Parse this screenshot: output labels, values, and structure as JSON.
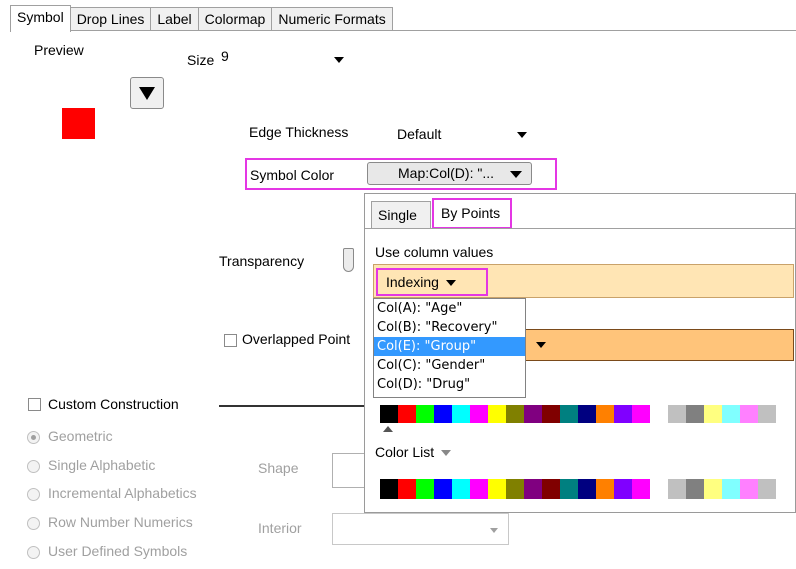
{
  "tabs": [
    "Symbol",
    "Drop Lines",
    "Label",
    "Colormap",
    "Numeric Formats"
  ],
  "preview_label": "Preview",
  "size": {
    "label": "Size",
    "value": "9"
  },
  "edge": {
    "label": "Edge Thickness",
    "value": "Default"
  },
  "symbol_color": {
    "label": "Symbol Color",
    "value": "Map:Col(D): \"..."
  },
  "transparency": {
    "label": "Transparency"
  },
  "overlapped": {
    "label": "Overlapped Point"
  },
  "custom": {
    "label": "Custom Construction"
  },
  "radios": [
    "Geometric",
    "Single Alphabetic",
    "Incremental Alphabetics",
    "Row Number Numerics",
    "User Defined Symbols"
  ],
  "shape_label": "Shape",
  "interior_label": "Interior",
  "popup": {
    "tabs": [
      "Single",
      "By Points"
    ],
    "use_column_label": "Use column values",
    "indexing_label": "Indexing",
    "columns": [
      "Col(A): \"Age\"",
      "Col(B): \"Recovery\"",
      "Col(E): \"Group\"",
      "Col(C): \"Gender\"",
      "Col(D): \"Drug\""
    ],
    "selected_column": "Col(E): \"Group\"",
    "color_list_label": "Color List"
  },
  "colors": {
    "accent_highlight": "#e436e4",
    "symbol_preview": "#ff0000",
    "selection": "#3399ff",
    "combo_bg": "#ffe5b4",
    "orange_bar": "#ffc47a",
    "palette": [
      "#000000",
      "#ff0000",
      "#00ff00",
      "#0000ff",
      "#00ffff",
      "#ff00ff",
      "#ffff00",
      "#808000",
      "#800080",
      "#800000",
      "#008080",
      "#000080",
      "#ff8000",
      "#8000ff",
      "#ff00ff",
      "#ffffff",
      "#c0c0c0",
      "#808080",
      "#ffff80",
      "#80ffff",
      "#ff80ff",
      "#c0c0c0"
    ]
  }
}
